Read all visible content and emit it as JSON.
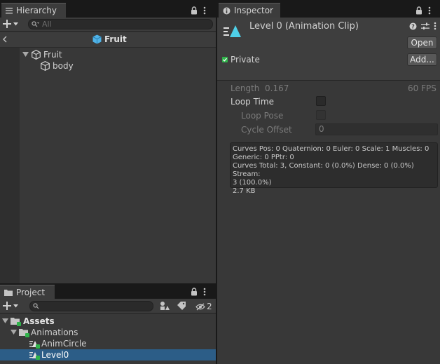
{
  "hierarchy": {
    "tab_label": "Hierarchy",
    "search_placeholder": "All",
    "breadcrumb": "Fruit",
    "tree": [
      {
        "label": "Fruit",
        "expanded": true
      },
      {
        "label": "body"
      }
    ]
  },
  "inspector": {
    "tab_label": "Inspector",
    "asset_title": "Level 0 (Animation Clip)",
    "open_button": "Open",
    "add_button": "Add...",
    "private_label": "Private",
    "length_label": "Length",
    "length_value": "0.167",
    "fps_value": "60 FPS",
    "loop_time_label": "Loop Time",
    "loop_pose_label": "Loop Pose",
    "cycle_offset_label": "Cycle Offset",
    "cycle_offset_value": "0",
    "info": [
      "Curves Pos: 0 Quaternion: 0 Euler: 0 Scale: 1 Muscles: 0",
      "Generic: 0 PPtr: 0",
      "Curves Total: 3, Constant: 0 (0.0%) Dense: 0 (0.0%) Stream:",
      "3 (100.0%)",
      "2.7 KB"
    ]
  },
  "project": {
    "tab_label": "Project",
    "hidden_count": "2",
    "tree": [
      {
        "label": "Assets"
      },
      {
        "label": "Animations"
      },
      {
        "label": "AnimCircle"
      },
      {
        "label": "Level0"
      }
    ]
  },
  "colors": {
    "selection": "#2c5d87",
    "accent_cyan": "#4fd0e8",
    "check_green": "#2fb34a"
  }
}
